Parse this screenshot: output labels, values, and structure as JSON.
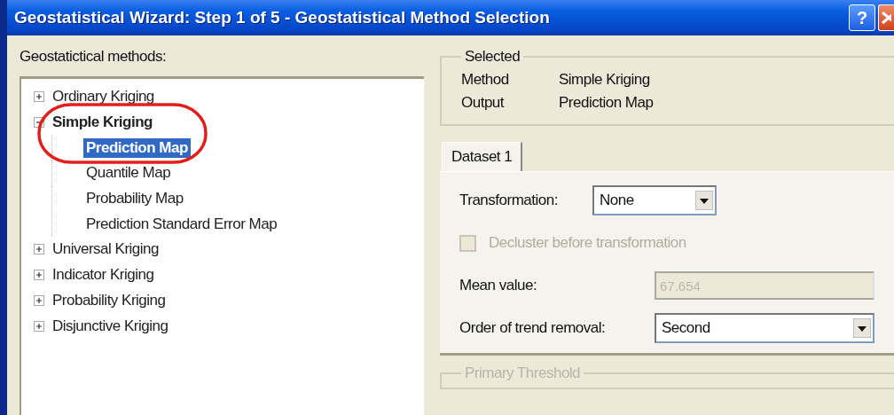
{
  "window": {
    "title": "Geostatistical Wizard: Step 1 of 5 - Geostatistical Method Selection",
    "title_buttons": [
      {
        "kind": "help",
        "label": "?"
      },
      {
        "kind": "close"
      }
    ]
  },
  "methods_label": "Geostatictical methods:",
  "tree": [
    {
      "label": "Ordinary Kriging",
      "expanded": false
    },
    {
      "label": "Simple Kriging",
      "expanded": true,
      "children": [
        {
          "label": "Prediction Map",
          "selected": true
        },
        {
          "label": "Quantile Map",
          "selected": false
        },
        {
          "label": "Probability Map",
          "selected": false
        },
        {
          "label": "Prediction Standard Error Map",
          "selected": false
        }
      ]
    },
    {
      "label": "Universal Kriging",
      "expanded": false
    },
    {
      "label": "Indicator Kriging",
      "expanded": false
    },
    {
      "label": "Probability Kriging",
      "expanded": false
    },
    {
      "label": "Disjunctive Kriging",
      "expanded": false
    }
  ],
  "annotation": {
    "kind": "ellipse"
  },
  "selected_group": {
    "title": "Selected",
    "rows": [
      {
        "label": "Method",
        "value": "Simple Kriging"
      },
      {
        "label": "Output",
        "value": "Prediction Map"
      }
    ]
  },
  "tabs": [
    {
      "label": "Dataset 1",
      "selected": true
    }
  ],
  "fields": [
    {
      "kind": "combo",
      "label": "Transformation:",
      "value": "None",
      "disabled": false
    },
    {
      "kind": "checkbox",
      "label": "Decluster before transformation",
      "checked": false,
      "disabled": true
    },
    {
      "kind": "text",
      "label": "Mean value:",
      "value": "67.654",
      "disabled": true
    },
    {
      "kind": "combo",
      "label": "Order of trend removal:",
      "value": "Second",
      "disabled": false
    }
  ],
  "threshold_group": {
    "title": "Primary Threshold",
    "disabled": true
  }
}
